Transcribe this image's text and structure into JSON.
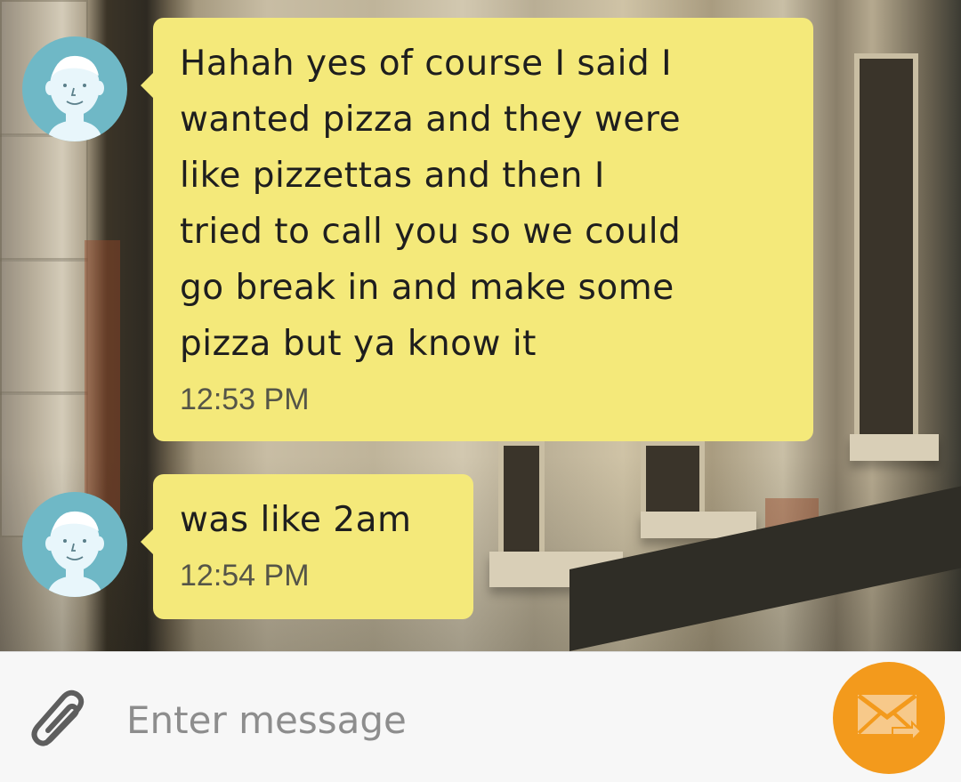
{
  "messages": [
    {
      "text": "Hahah yes of course I said I\nwanted pizza and they were\nlike pizzettas and then I\ntried to call you so we could\ngo break in and make some\npizza but ya know it",
      "time": "12:53 PM",
      "avatar_icon": "person-avatar-icon"
    },
    {
      "text": "was like 2am",
      "time": "12:54 PM",
      "avatar_icon": "person-avatar-icon"
    }
  ],
  "composer": {
    "placeholder": "Enter message",
    "attach_icon": "paperclip-icon",
    "send_icon": "send-envelope-icon"
  },
  "colors": {
    "bubble": "#f4e97a",
    "avatar": "#6fb8c6",
    "send_button": "#f39a1c",
    "composer_bg": "#f7f7f7"
  }
}
